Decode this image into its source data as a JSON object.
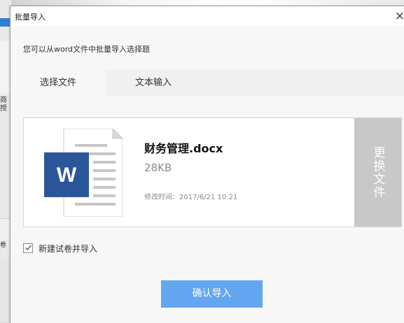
{
  "background_app": {
    "side_chars": [
      "商",
      "授"
    ],
    "side_label": "卷"
  },
  "dialog": {
    "title": "批量导入",
    "close_glyph": "×",
    "instruction": "您可以从word文件中批量导入选择题",
    "tabs": [
      {
        "label": "选择文件",
        "active": true
      },
      {
        "label": "文本输入",
        "active": false
      }
    ],
    "file": {
      "name": "财务管理.docx",
      "size": "28KB",
      "modified": "修改时间：2017/6/21 10:21",
      "icon": "word-document-icon",
      "icon_letter": "W"
    },
    "replace_button": "更换文件",
    "new_paper_checkbox": {
      "label": "新建试卷并导入",
      "checked": true
    },
    "confirm_button": "确认导入"
  },
  "colors": {
    "word_blue": "#2b579a",
    "confirm_button": "#62a7f0",
    "replace_button": "#c8c8c8"
  }
}
